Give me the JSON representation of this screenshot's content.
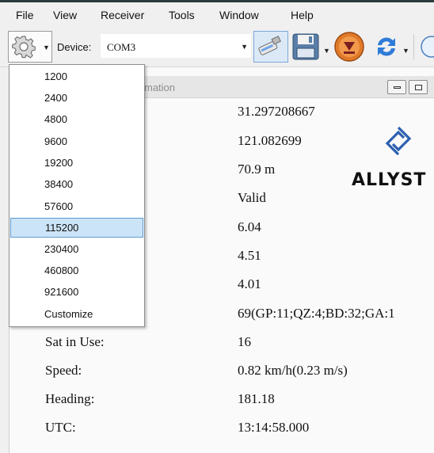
{
  "menu": [
    "File",
    "View",
    "Receiver",
    "Tools",
    "Window",
    "Help"
  ],
  "toolbar": {
    "device_label": "Device:",
    "device_value": "COM3",
    "icons": [
      "gear-icon",
      "usb-icon",
      "save-disk-icon",
      "download-icon",
      "refresh-icon",
      "globe-icon"
    ]
  },
  "baud_menu": {
    "items": [
      "1200",
      "2400",
      "4800",
      "9600",
      "19200",
      "38400",
      "57600",
      "115200",
      "230400",
      "460800",
      "921600",
      "Customize"
    ],
    "selected": "115200"
  },
  "panel": {
    "title_fragment": "mation",
    "values": [
      "31.297208667",
      "121.082699",
      "70.9 m",
      "Valid",
      "6.04",
      "4.51",
      "4.01",
      "69(GP:11;QZ:4;BD:32;GA:1"
    ],
    "rows": [
      {
        "label": "Sat in Use:",
        "value": "16"
      },
      {
        "label": "Speed:",
        "value": "0.82 km/h(0.23 m/s)"
      },
      {
        "label": "Heading:",
        "value": "181.18"
      },
      {
        "label": "UTC:",
        "value": "13:14:58.000"
      }
    ],
    "logo_text": "ALLYST"
  },
  "colors": {
    "background": "#2f3f43",
    "selection": "#cce4f7",
    "selection_border": "#5b9bd5",
    "logo_blue": "#2c5fb0"
  }
}
